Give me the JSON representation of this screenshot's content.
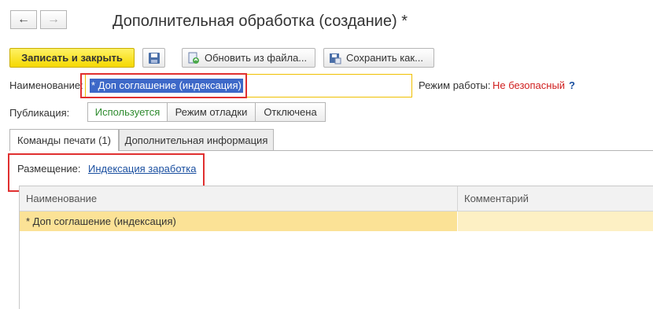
{
  "nav": {
    "back_icon": "arrow-left-icon",
    "forward_icon": "arrow-right-icon"
  },
  "window": {
    "title": "Дополнительная обработка (создание) *"
  },
  "toolbar": {
    "save_close_label": "Записать и закрыть",
    "save_icon": "floppy-disk-icon",
    "update_from_file_label": "Обновить из файла...",
    "save_as_label": "Сохранить как..."
  },
  "form": {
    "name_label": "Наименование:",
    "name_value": "* Доп соглашение (индексация)",
    "mode_label": "Режим работы:",
    "mode_value": "Не безопасный",
    "mode_help": "?",
    "publication_label": "Публикация:",
    "publication_options": [
      "Используется",
      "Режим отладки",
      "Отключена"
    ],
    "publication_selected": "Используется"
  },
  "tabs": [
    {
      "label": "Команды печати (1)",
      "active": true
    },
    {
      "label": "Дополнительная информация",
      "active": false
    }
  ],
  "placement": {
    "label": "Размещение:",
    "value": "Индексация заработка"
  },
  "table": {
    "columns": [
      "Наименование",
      "Комментарий"
    ],
    "rows": [
      {
        "name": "* Доп соглашение (индексация)",
        "comment": ""
      }
    ]
  },
  "colors": {
    "primary_button": "#f5d800",
    "selection": "#3d68c8",
    "unsafe_mode": "#d02020",
    "active_segment_text": "#2e8b2e",
    "link": "#1a4fa0",
    "highlight_box": "#e03030",
    "selected_row": "#fbe296"
  }
}
